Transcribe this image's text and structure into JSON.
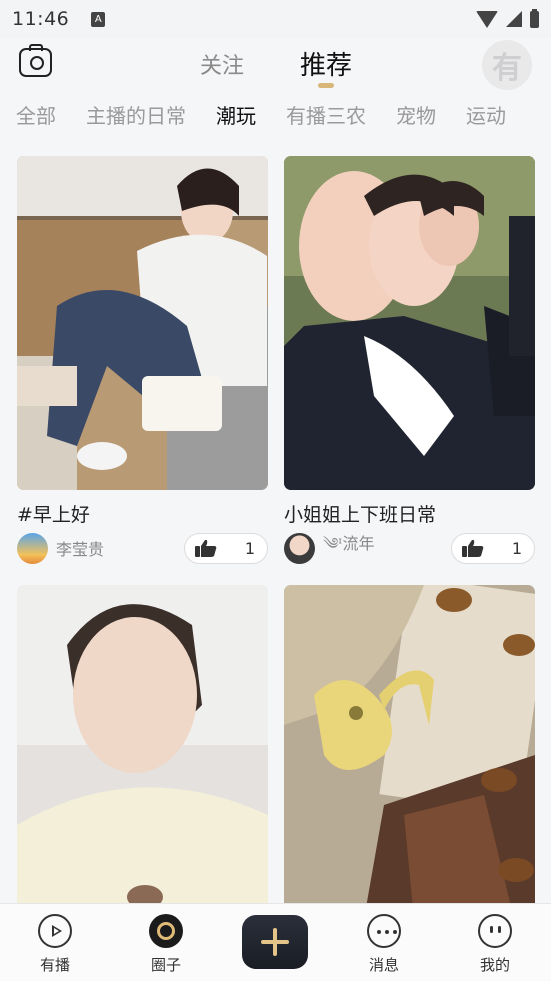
{
  "status_bar": {
    "time": "11:46",
    "notif_glyph": "A"
  },
  "header": {
    "tabs": [
      {
        "label": "关注"
      },
      {
        "label": "推荐"
      }
    ],
    "active_tab": "推荐",
    "avatar_glyph": "有",
    "accent_color": "#d8b77a"
  },
  "categories": [
    {
      "label": "全部"
    },
    {
      "label": "主播的日常"
    },
    {
      "label": "潮玩"
    },
    {
      "label": "有播三农"
    },
    {
      "label": "宠物"
    },
    {
      "label": "运动"
    }
  ],
  "active_category": "潮玩",
  "feed": [
    {
      "title": "#早上好",
      "user": "李莹贵",
      "likes": "1",
      "thumb_desc": "woman in white top sitting on chair"
    },
    {
      "title": "小姐姐上下班日常",
      "user": "༄ᶦ流年",
      "likes": "1",
      "thumb_desc": "group selfie of women in uniforms"
    },
    {
      "title": "",
      "user": "",
      "likes": "",
      "thumb_desc": "woman selfie in white sweater"
    },
    {
      "title": "",
      "user": "",
      "likes": "",
      "thumb_desc": "yellow teapot still life with acorns"
    }
  ],
  "bottom_nav": {
    "items": [
      {
        "label": "有播",
        "icon": "play-icon"
      },
      {
        "label": "圈子",
        "icon": "circle-icon"
      },
      {
        "label": "",
        "icon": "add-icon"
      },
      {
        "label": "消息",
        "icon": "message-icon"
      },
      {
        "label": "我的",
        "icon": "profile-icon"
      }
    ],
    "active": "圈子",
    "add_button_color": "#e5c489"
  }
}
